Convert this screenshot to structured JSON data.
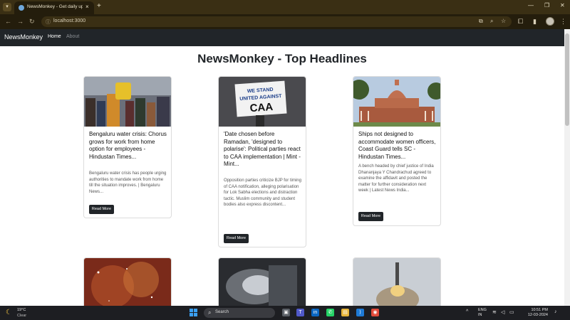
{
  "browser": {
    "tab_title": "NewsMonkey - Get daily upd...",
    "url": "localhost:3000",
    "tab_close": "×",
    "new_tab": "+"
  },
  "navbar": {
    "brand": "NewsMonkey",
    "links": [
      "Home",
      "About"
    ]
  },
  "page": {
    "title": "NewsMonkey - Top Headlines"
  },
  "cards": [
    {
      "title": "Bengaluru water crisis: Chorus grows for work from home option for employees - Hindustan Times...",
      "description": "Bengaluru water crisis has people urging authorities to mandate work from home till the situation improves. | Bengaluru News...",
      "button": "Read More"
    },
    {
      "title": "'Date chosen before Ramadan, 'designed to polarise': Political parties react to CAA implementation | Mint - Mint...",
      "description": "Opposition parties criticize BJP for timing of CAA notification, alleging polarisation for Lok Sabha elections and distraction tactic. Muslim community and student bodies also express discontent...",
      "button": "Read More",
      "image_text": [
        "WE STAND",
        "UNITED AGAINST",
        "CAA"
      ]
    },
    {
      "title": "Ships not designed to accommodate women officers, Coast Guard tells SC - Hindustan Times...",
      "description": "A bench headed by chief justice of India Dhananjaya Y Chandrachud agreed to examine the affidavit and posted the matter for further consideration next week | Latest News India...",
      "button": "Read More"
    }
  ],
  "taskbar": {
    "weather_temp": "19°C",
    "weather_cond": "Clear",
    "search_label": "Search",
    "lang_line1": "ENG",
    "lang_line2": "IN",
    "time": "10:51 PM",
    "date": "12-03-2024"
  }
}
